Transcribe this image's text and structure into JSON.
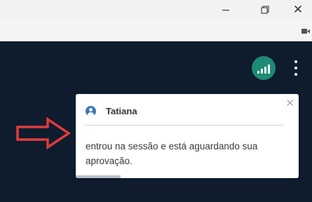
{
  "window": {
    "minimize_icon": "minimize-icon",
    "restore_icon": "restore-icon",
    "close_label": "✕"
  },
  "toolbar": {
    "camera_icon": "video-camera-icon"
  },
  "meeting": {
    "connection_status_icon": "signal-bars-icon",
    "more_options_icon": "more-vertical-icon"
  },
  "notification": {
    "user_name": "Tatiana",
    "message": "entrou na sessão e está aguardando sua aprovação.",
    "close_label": "✕",
    "progress": 0.2
  },
  "annotation": {
    "arrow_color": "#e23b3b"
  },
  "colors": {
    "app_background": "#0e1c2e",
    "signal_button": "#1f8a73",
    "user_icon": "#3d74b8"
  }
}
